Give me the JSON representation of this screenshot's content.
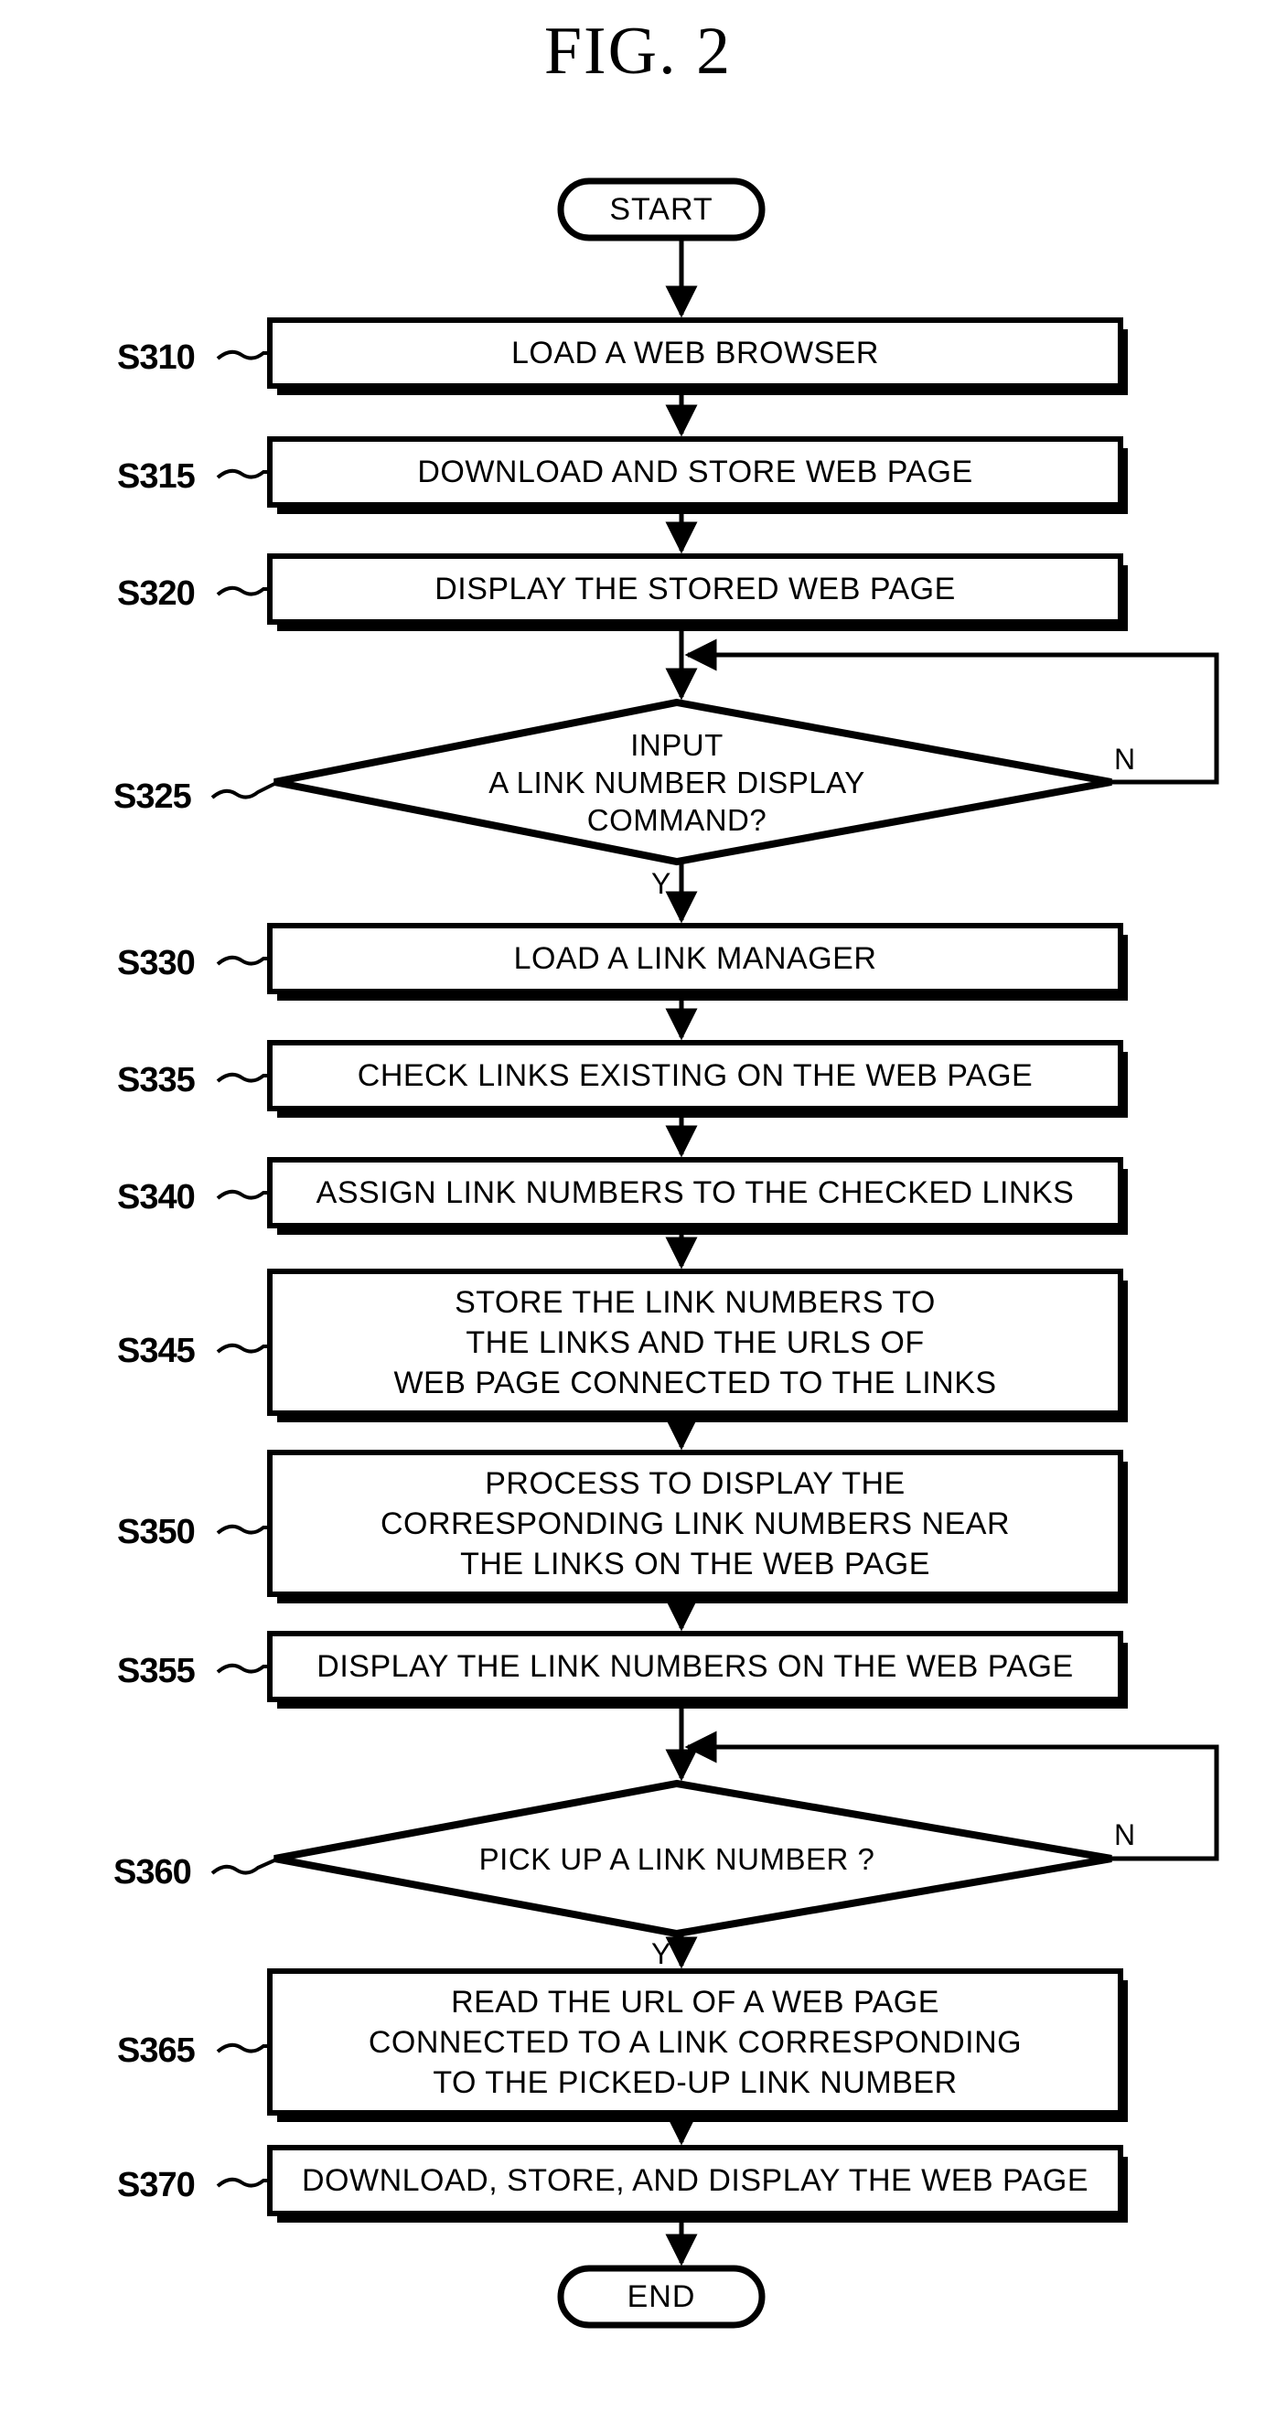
{
  "figure": {
    "title": "FIG.  2"
  },
  "nodes": {
    "start": {
      "id": "start",
      "label": "START",
      "shape": "terminal"
    },
    "end": {
      "id": "end",
      "label": "END",
      "shape": "terminal"
    },
    "s310": {
      "step": "S310",
      "label": "LOAD A WEB BROWSER",
      "shape": "process"
    },
    "s315": {
      "step": "S315",
      "label": "DOWNLOAD AND STORE WEB PAGE",
      "shape": "process"
    },
    "s320": {
      "step": "S320",
      "label": "DISPLAY THE STORED WEB PAGE",
      "shape": "process"
    },
    "s325": {
      "step": "S325",
      "label": "INPUT\nA LINK NUMBER DISPLAY\nCOMMAND?",
      "shape": "decision",
      "yes_label": "Y",
      "no_label": "N"
    },
    "s330": {
      "step": "S330",
      "label": "LOAD A LINK MANAGER",
      "shape": "process"
    },
    "s335": {
      "step": "S335",
      "label": "CHECK LINKS EXISTING ON THE WEB PAGE",
      "shape": "process"
    },
    "s340": {
      "step": "S340",
      "label": "ASSIGN LINK NUMBERS TO THE CHECKED LINKS",
      "shape": "process"
    },
    "s345": {
      "step": "S345",
      "label": "STORE THE LINK NUMBERS TO\nTHE LINKS AND THE URLS OF\nWEB PAGE CONNECTED TO THE LINKS",
      "shape": "process"
    },
    "s350": {
      "step": "S350",
      "label": "PROCESS TO DISPLAY THE\nCORRESPONDING LINK NUMBERS NEAR\nTHE LINKS ON THE WEB PAGE",
      "shape": "process"
    },
    "s355": {
      "step": "S355",
      "label": "DISPLAY THE LINK NUMBERS ON THE WEB PAGE",
      "shape": "process"
    },
    "s360": {
      "step": "S360",
      "label": "PICK UP A LINK NUMBER ?",
      "shape": "decision",
      "yes_label": "Y",
      "no_label": "N"
    },
    "s365": {
      "step": "S365",
      "label": "READ THE URL OF A WEB PAGE\nCONNECTED TO A LINK CORRESPONDING\nTO THE PICKED-UP LINK NUMBER",
      "shape": "process"
    },
    "s370": {
      "step": "S370",
      "label": "DOWNLOAD, STORE, AND DISPLAY THE WEB PAGE",
      "shape": "process"
    }
  },
  "colors": {
    "stroke": "#000000",
    "fill": "#ffffff",
    "background": "#ffffff"
  }
}
